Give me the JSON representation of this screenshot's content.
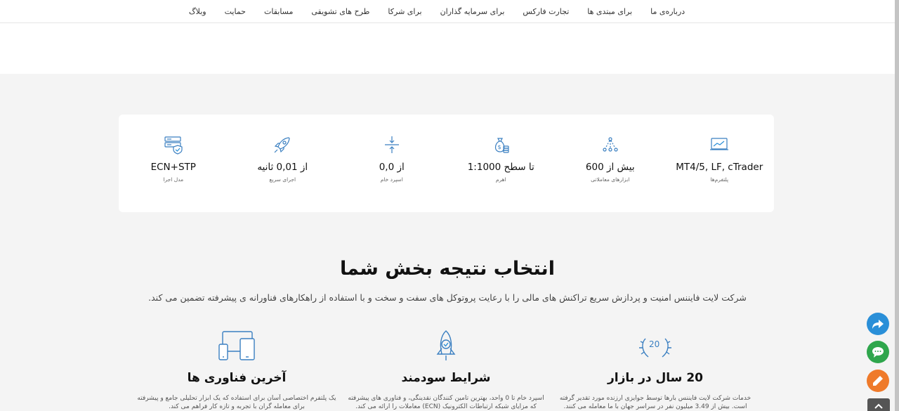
{
  "nav": {
    "items": [
      "درباره‌ی ما",
      "برای مبتدی ها",
      "تجارت فارکس",
      "برای سرمایه گذاران",
      "برای شرکا",
      "طرح های تشویقی",
      "مسابقات",
      "حمایت",
      "وبلاگ"
    ]
  },
  "stats": [
    {
      "icon": "chart-monitor-icon",
      "value": "MT4/5, LF, cTrader",
      "label": "پلتفرم‌ها"
    },
    {
      "icon": "network-nodes-icon",
      "value": "بیش از 600",
      "label": "ابزارهای معاملاتی"
    },
    {
      "icon": "money-bag-icon",
      "value": "تا سطح 1:1000",
      "label": "اهرم"
    },
    {
      "icon": "compress-arrows-icon",
      "value": "از 0,0",
      "label": "اسپرد خام"
    },
    {
      "icon": "rocket-icon",
      "value": "از 0,01 ثانیه",
      "label": "اجرای سریع"
    },
    {
      "icon": "server-shield-icon",
      "value": "ECN+STP",
      "label": "مدل اجرا"
    }
  ],
  "section": {
    "title": "انتخاب نتیجه بخش شما",
    "subtitle": "شرکت لایت فایننس امنیت و پردازش سریع تراکنش های مالی را با رعایت پروتوکل های سفت و سخت و با استفاده از راهکارهای فناورانه ی پیشرفته تضمین می کند."
  },
  "features": [
    {
      "icon": "laurel-20-icon",
      "title": "20 سال در بازار",
      "desc": "خدمات شرکت لایت فایننس بارها توسط جوایزی ارزنده مورد تقدیر گرفته است. بیش از 3.49 میلیون نفر در سراسر جهان با ما معامله می کنند."
    },
    {
      "icon": "rocket-badge-icon",
      "title": "شرایط سودمند",
      "desc": "اسپرد خام تا 0 واحد، بهترین تامین کنندگان نقدینگی، و فناوری های پیشرفته که مزایای شبکه ارتباطات الکترونیک (ECN) معاملات را ارائه می کند."
    },
    {
      "icon": "devices-icon",
      "title": "آخرین فناوری ها",
      "desc": "یک پلتفرم اختصاصی آسان برای استفاده که یک ابزار تحلیلی جامع و پیشرفته برای معامله گران با تجربه و تازه کار فراهم می کند."
    }
  ],
  "colors": {
    "accent": "#2a8fd8",
    "chat": "#2fa64c",
    "edit": "#ef7a2a",
    "icon": "#3a7fc1"
  }
}
